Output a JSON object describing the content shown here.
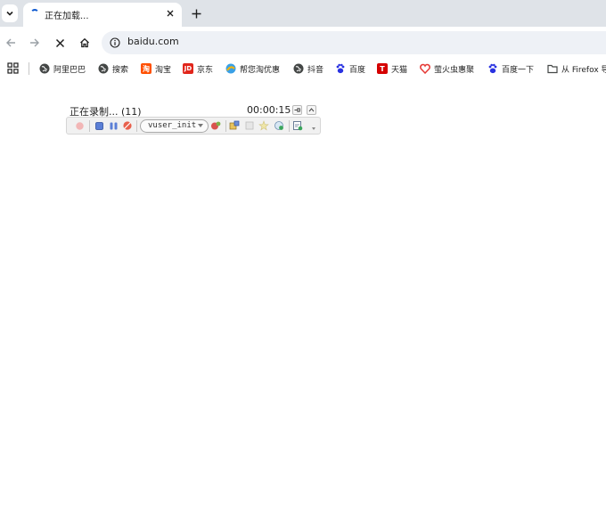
{
  "tab": {
    "title": "正在加载..."
  },
  "address_bar": {
    "url": "baidu.com"
  },
  "bookmarks": [
    {
      "label": "阿里巴巴",
      "icon": "globe-icon",
      "color": "#444746"
    },
    {
      "label": "搜索",
      "icon": "globe-icon",
      "color": "#444746"
    },
    {
      "label": "淘宝",
      "icon": "taobao-icon",
      "color": "#ff5000"
    },
    {
      "label": "京东",
      "icon": "jd-icon",
      "color": "#e1251b"
    },
    {
      "label": "帮您淘优惠",
      "icon": "coupon-icon",
      "color": "#3aa0e6"
    },
    {
      "label": "抖音",
      "icon": "globe-icon",
      "color": "#444746"
    },
    {
      "label": "百度",
      "icon": "baidu-paw-icon",
      "color": "#2932e1"
    },
    {
      "label": "天猫",
      "icon": "tmall-icon",
      "color": "#d50000"
    },
    {
      "label": "萤火虫惠聚",
      "icon": "firefly-icon",
      "color": "#e53935"
    },
    {
      "label": "百度一下",
      "icon": "baidu-paw-icon",
      "color": "#2932e1"
    },
    {
      "label": "从 Firefox 导入",
      "icon": "folder-icon",
      "color": "#444746"
    }
  ],
  "recorder": {
    "title": "正在录制... (11)",
    "time": "00:00:15",
    "action": "vuser_init"
  }
}
